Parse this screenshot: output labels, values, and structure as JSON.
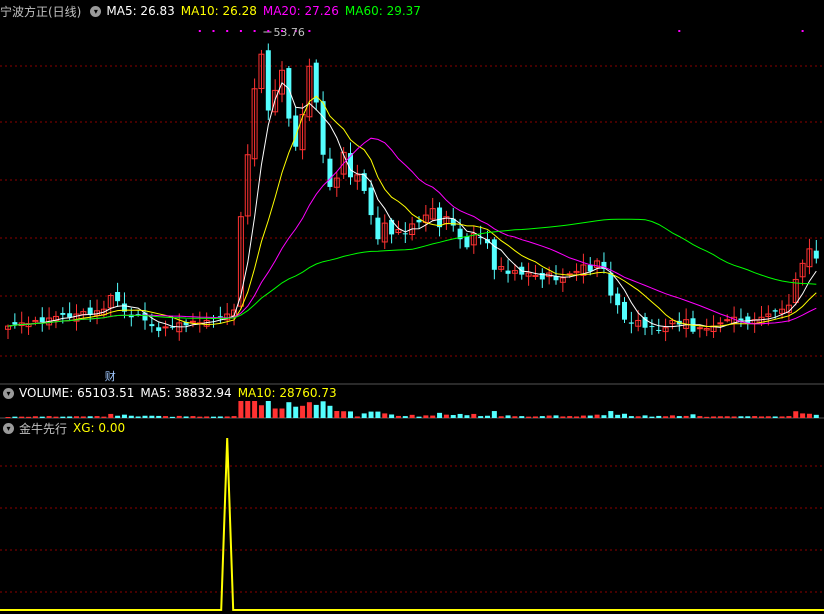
{
  "panels": {
    "price": {
      "title": "宁波方正(日线)",
      "ma_labels": [
        "MA5: 26.83",
        "MA10: 26.28",
        "MA20: 27.26",
        "MA60: 29.37"
      ],
      "peak_label": "53.76",
      "event_marker": "财"
    },
    "volume": {
      "labels": [
        "VOLUME: 65103.51",
        "MA5: 38832.94",
        "MA10: 28760.73"
      ]
    },
    "indicator": {
      "title": "金牛先行",
      "labels": [
        "XG: 0.00"
      ]
    }
  },
  "colors": {
    "background": "#000000",
    "up_candle": "#ff3232",
    "down_candle": "#54ffff",
    "ma5": "#ffffff",
    "ma10": "#ffff00",
    "ma20": "#ff00ff",
    "ma60": "#00ff00",
    "xg_line": "#ffff00",
    "grid": "#8b0000",
    "title_text": "#c0c0c0",
    "label_text": "#c0c0c0"
  },
  "icons": [
    "collapse-circle-icon"
  ],
  "chart_data": [
    {
      "type": "candlestick",
      "title": "宁波方正(日线)",
      "ylim": [
        10.5,
        55.5
      ],
      "series": [
        {
          "name": "MA5",
          "latest": 26.83
        },
        {
          "name": "MA10",
          "latest": 26.28
        },
        {
          "name": "MA20",
          "latest": 27.26
        },
        {
          "name": "MA60",
          "latest": 29.37
        }
      ],
      "annotations": [
        "53.76"
      ],
      "close": [
        17.2,
        17.4,
        17.6,
        17.5,
        17.9,
        17.7,
        18.2,
        18.4,
        18.6,
        18.3,
        18.7,
        19.0,
        18.6,
        19.1,
        19.3,
        21.0,
        20.3,
        19.0,
        18.3,
        18.6,
        17.9,
        17.2,
        16.6,
        17.1,
        17.0,
        17.6,
        17.3,
        17.8,
        17.6,
        17.9,
        18.1,
        18.4,
        18.7,
        19.2,
        30.8,
        38.5,
        46.7,
        51.0,
        44.0,
        46.5,
        49.0,
        43.0,
        39.5,
        43.5,
        49.5,
        45.0,
        38.5,
        34.5,
        35.6,
        38.8,
        35.7,
        36.0,
        34.0,
        31.0,
        28.0,
        30.0,
        28.6,
        29.2,
        28.7,
        29.9,
        30.1,
        31.0,
        31.8,
        29.5,
        30.8,
        29.7,
        28.0,
        27.0,
        28.7,
        28.2,
        27.5,
        24.2,
        24.6,
        23.7,
        24.1,
        23.6,
        23.8,
        23.5,
        23.0,
        23.8,
        22.9,
        23.2,
        23.7,
        24.0,
        24.8,
        24.0,
        25.3,
        24.3,
        21.0,
        19.8,
        18.0,
        17.5,
        17.9,
        17.0,
        17.2,
        16.6,
        17.0,
        17.9,
        17.4,
        18.0,
        16.5,
        17.0,
        16.9,
        17.2,
        17.6,
        18.0,
        18.3,
        17.9,
        17.5,
        18.0,
        18.3,
        18.7,
        19.0,
        19.3,
        19.8,
        23.0,
        25.0,
        26.8,
        25.6
      ],
      "highs_shown_as": "wicks",
      "volume_panel": {
        "labels": [
          "VOLUME: 65103.51",
          "MA5: 38832.94",
          "MA10: 28760.73"
        ],
        "volume": 65103.51,
        "ma5": 38832.94,
        "ma10": 28760.73
      },
      "indicator_panel": {
        "name": "金牛先行",
        "series": "XG",
        "latest": 0.0,
        "signal_at_index": 32,
        "values": "0 everywhere except a single spike to 1 at index 32"
      }
    }
  ]
}
